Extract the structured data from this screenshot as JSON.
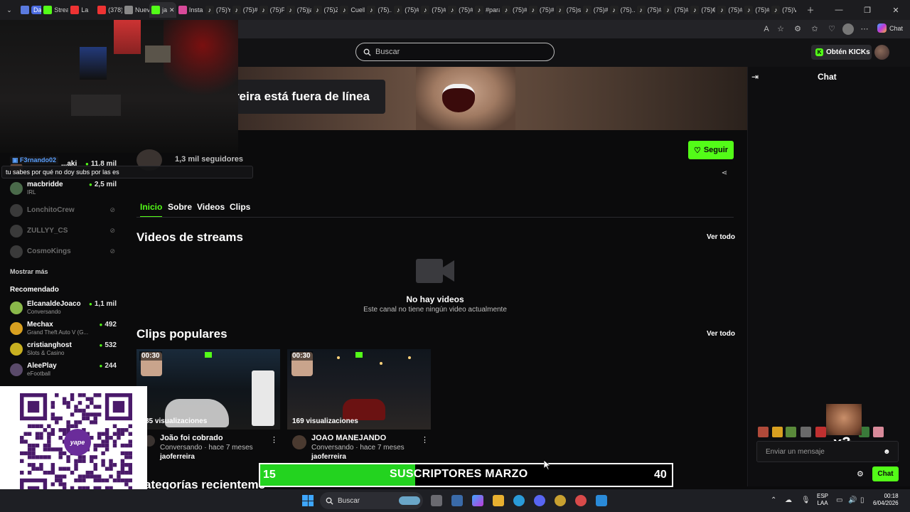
{
  "browser": {
    "tabs": [
      "Dashb",
      "Strea",
      "La",
      "(378)",
      "Nuev",
      "ja",
      "Insta",
      "(75)Y",
      "(75)#",
      "(75)P",
      "(75)ja",
      "(75)Z",
      "Cuell",
      "(75)...",
      "(75)#",
      "(75)#",
      "(75)#",
      "#para",
      "(75)#",
      "(75)#",
      "(75)s",
      "(75)#",
      "(75)...",
      "(75)#",
      "(75)#",
      "(75)€",
      "(75)#",
      "(75)#",
      "(75)V"
    ],
    "active_tab_index": 5,
    "copilot_label": "Chat"
  },
  "header": {
    "search_placeholder": "Buscar",
    "kicks_label": "Obtén KICKs"
  },
  "banner": {
    "offline_text": "erreira está fuera de línea"
  },
  "chat_overlay": {
    "user": "F3rnando02",
    "message": "tu sabes por qué no doy subs por las es"
  },
  "channel": {
    "followers": "1,3 mil seguidores",
    "follow_label": "Seguir",
    "tabs": [
      "Inicio",
      "Sobre",
      "Videos",
      "Clips"
    ]
  },
  "videos": {
    "title": "Videos de streams",
    "see_all": "Ver todo",
    "empty_title": "No hay videos",
    "empty_sub": "Este canal no tiene ningún video actualmente"
  },
  "clips": {
    "title": "Clips populares",
    "see_all": "Ver todo",
    "items": [
      {
        "duration": "00:30",
        "views": "85 visualizaciones",
        "title": "João foi cobrado",
        "meta": "Conversando · hace 7 meses",
        "author": "jaoferreira"
      },
      {
        "duration": "00:30",
        "views": "169 visualizaciones",
        "title": "JOAO MANEJANDO",
        "meta": "Conversando · hace 7 meses",
        "author": "jaoferreira"
      }
    ]
  },
  "categories": {
    "title": "ategorías recienteme"
  },
  "sidebar": {
    "following": [
      {
        "name": "...aki",
        "viewers": "11,8 mil",
        "live": true,
        "color": "#6a4a3a"
      },
      {
        "name": "macbridde",
        "category": "IRL",
        "viewers": "2,5 mil",
        "live": true,
        "color": "#4a6a4a"
      },
      {
        "name": "LonchitoCrew",
        "live": false,
        "color": "#3a3a3a"
      },
      {
        "name": "ZULLYY_CS",
        "live": false,
        "color": "#3a3a3a"
      },
      {
        "name": "CosmoKings",
        "live": false,
        "color": "#3a3a3a"
      }
    ],
    "show_more": "Mostrar más",
    "recommended_title": "Recomendado",
    "recommended": [
      {
        "name": "ElcanaldeJoaco",
        "category": "Conversando",
        "viewers": "1,1 mil",
        "color": "#8ab84a"
      },
      {
        "name": "Mechax",
        "category": "Grand Theft Auto V (G...",
        "viewers": "492",
        "color": "#d8a020"
      },
      {
        "name": "cristianghost",
        "category": "Slots & Casino",
        "viewers": "532",
        "color": "#c8b020"
      },
      {
        "name": "AleePlay",
        "category": "eFootball",
        "viewers": "244",
        "color": "#5a4a6a"
      }
    ]
  },
  "qr": {
    "brand": "yape"
  },
  "chat": {
    "title": "Chat",
    "input_placeholder": "Enviar un mensaje",
    "send_label": "Chat",
    "overlay_text": "x3"
  },
  "sub_goal": {
    "current": "15",
    "title": "SUSCRIPTORES MARZO",
    "target": "40"
  },
  "taskbar": {
    "search_label": "Buscar",
    "lang_line1": "ESP",
    "lang_line2": "LAA",
    "time": "00:18",
    "date": "6/04/2026"
  },
  "colors": {
    "accent": "#53fc18",
    "background": "#0b0b0c",
    "progress": "#23d31f"
  }
}
